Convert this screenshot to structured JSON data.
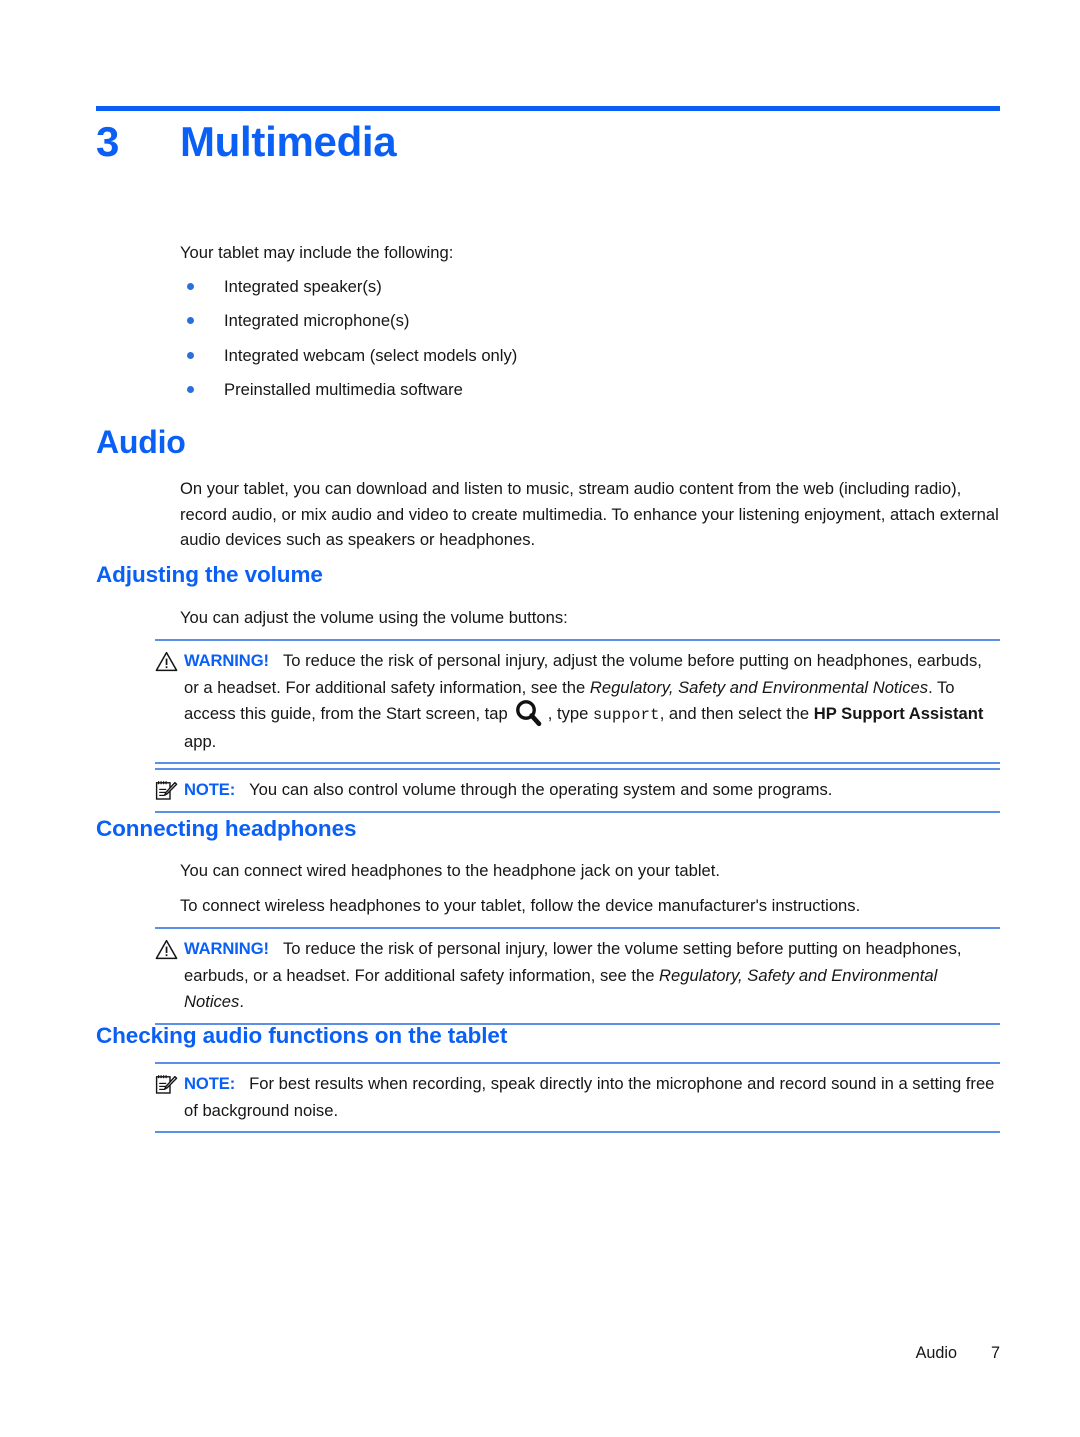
{
  "document": {
    "chapter_number": "3",
    "chapter_title": "Multimedia"
  },
  "intro": {
    "lead": "Your tablet may include the following:",
    "bullets": [
      "Integrated speaker(s)",
      "Integrated microphone(s)",
      "Integrated webcam (select models only)",
      "Preinstalled multimedia software"
    ]
  },
  "sections": {
    "audio": {
      "heading": "Audio",
      "paragraph": "On your tablet, you can download and listen to music, stream audio content from the web (including radio), record audio, or mix audio and video to create multimedia. To enhance your listening enjoyment, attach external audio devices such as speakers or headphones."
    },
    "adjusting_volume": {
      "heading": "Adjusting the volume",
      "paragraph": "You can adjust the volume using the volume buttons:",
      "warning": {
        "label": "WARNING!",
        "text_1": "To reduce the risk of personal injury, adjust the volume before putting on headphones, earbuds, or a headset. For additional safety information, see the ",
        "guide_title_1": "Regulatory, Safety and Environmental Notices",
        "text_2": ". To access this guide, from the Start screen, tap",
        "text_3": ", type ",
        "command": "support",
        "text_4": ", and then select the ",
        "app_name": "HP Support Assistant",
        "text_5": " app.",
        "icon": "search-icon"
      },
      "note": {
        "label": "NOTE:",
        "text": "You can also control volume through the operating system and some programs.",
        "icon": "note-pencil-icon"
      }
    },
    "connecting_headphones": {
      "heading": "Connecting headphones",
      "paragraph_1": "You can connect wired headphones to the headphone jack on your tablet.",
      "paragraph_2": "To connect wireless headphones to your tablet, follow the device manufacturer's instructions.",
      "warning": {
        "label": "WARNING!",
        "text_1": "To reduce the risk of personal injury, lower the volume setting before putting on headphones, earbuds, or a headset. For additional safety information, see the ",
        "guide_title": "Regulatory, Safety and Environmental Notices",
        "text_2": ".",
        "icon": "warning-triangle-icon"
      }
    },
    "checking_audio": {
      "heading": "Checking audio functions on the tablet",
      "note": {
        "label": "NOTE:",
        "text": "For best results when recording, speak directly into the microphone and record sound in a setting free of background noise.",
        "icon": "note-pencil-icon"
      }
    }
  },
  "footer": {
    "section": "Audio",
    "page_number": "7"
  },
  "colors": {
    "accent_blue": "#0a5ff5",
    "rule_blue": "#5b8fe8",
    "bullet_blue": "#2a6fe0",
    "text_black": "#161616"
  }
}
